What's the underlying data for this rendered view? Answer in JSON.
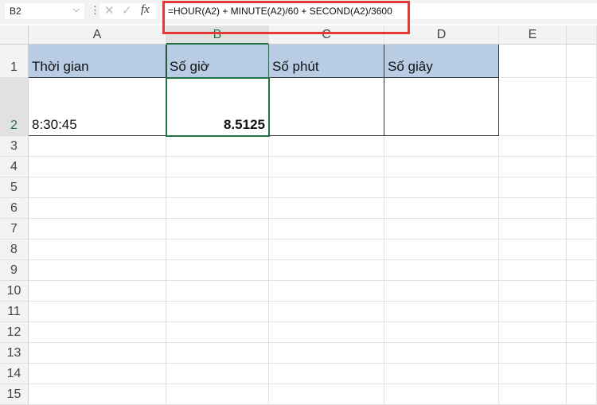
{
  "name_box": "B2",
  "formula": "=HOUR(A2) + MINUTE(A2)/60 + SECOND(A2)/3600",
  "columns": [
    "A",
    "B",
    "C",
    "D",
    "E"
  ],
  "rows": [
    "1",
    "2",
    "3",
    "4",
    "5",
    "6",
    "7",
    "8",
    "9",
    "10",
    "11",
    "12",
    "13",
    "14",
    "15"
  ],
  "cells": {
    "A1": "Thời gian",
    "B1": "Số giờ",
    "C1": "Số phút",
    "D1": "Số giây",
    "A2": "8:30:45",
    "B2": "8.5125"
  },
  "colors": {
    "header_fill": "#b8cce4",
    "selection": "#217346",
    "highlight": "#e53935"
  }
}
